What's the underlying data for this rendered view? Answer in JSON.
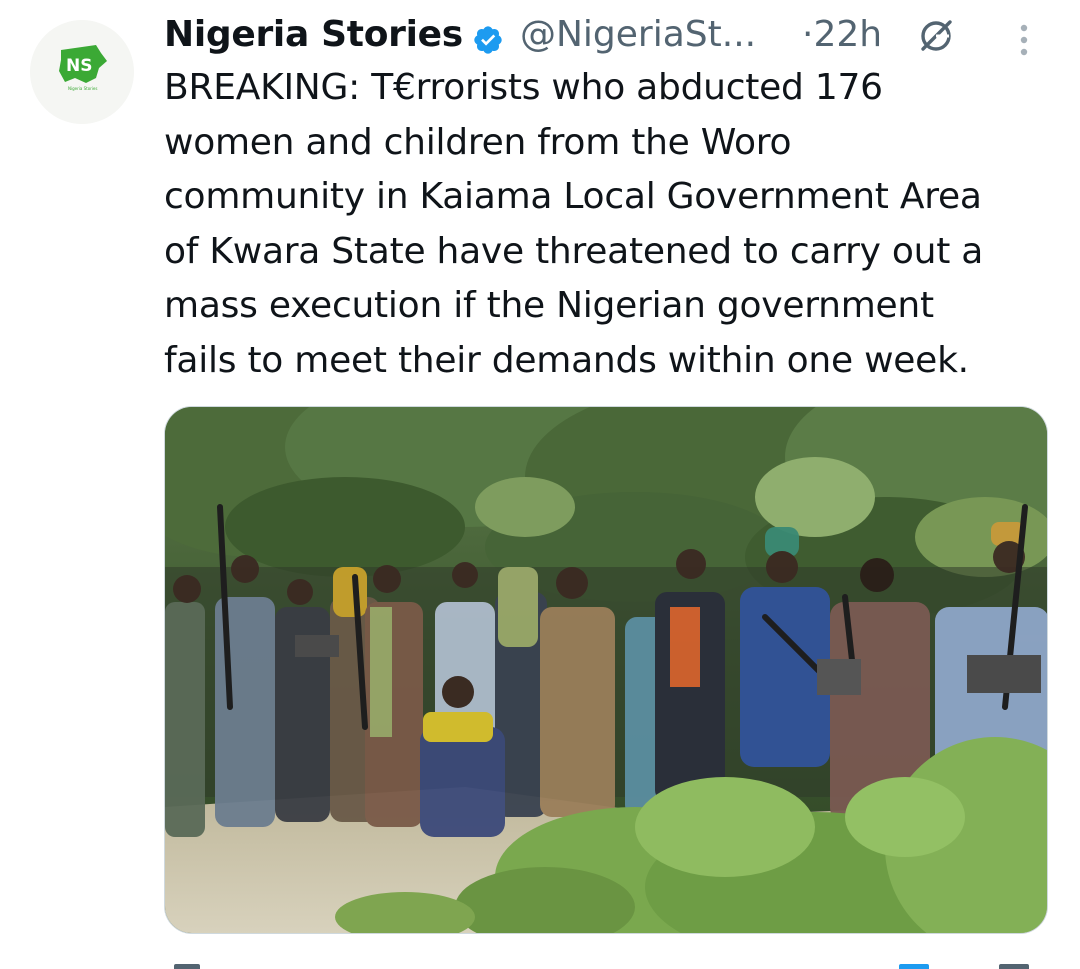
{
  "author": {
    "name": "Nigeria Stories",
    "handle": "@NigeriaSt...",
    "time": "·22h",
    "avatar_text": "NS",
    "avatar_subtext": "Nigeria Stories",
    "verified_icon": "verified-badge-icon"
  },
  "tweet": {
    "lines": [
      "BREAKING: T€rrorists who abducted 176",
      "women and children from the Woro",
      "community in Kaiama Local Government Area",
      "of Kwara State have threatened to carry out a",
      "mass execution if the Nigerian government",
      "fails to meet their demands within one week."
    ]
  },
  "icons": {
    "grok": "grok-icon",
    "more": "more-options-icon"
  },
  "colors": {
    "verified": "#1d9bf0",
    "secondary_text": "#536471",
    "brand_green": "#3ba935",
    "brand_yellow": "#f0e21b"
  }
}
